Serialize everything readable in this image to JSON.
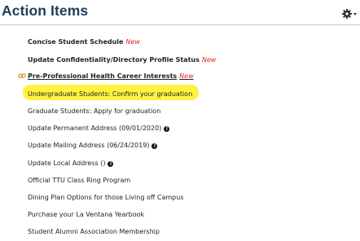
{
  "header": {
    "title": "Action Items",
    "icon": "gear-icon"
  },
  "items": [
    {
      "label": "Concise Student Schedule",
      "new": "New",
      "bold": true,
      "link": false,
      "info": false
    },
    {
      "label": "Update Confidentiality/Directory Profile Status",
      "new": "New",
      "bold": true,
      "link": false,
      "info": false
    },
    {
      "label": "Pre-Professional Health Career Interests",
      "new": "New",
      "bold": true,
      "link": true,
      "info": false,
      "icon": "chain-link-icon"
    },
    {
      "label": "Undergraduate Students: Confirm your graduation",
      "new": "",
      "bold": false,
      "link": false,
      "info": false,
      "highlighted": true
    },
    {
      "label": "Graduate Students: Apply for graduation",
      "new": "",
      "bold": false,
      "link": false,
      "info": false
    },
    {
      "label": "Update Permanent Address (09/01/2020)",
      "new": "",
      "bold": false,
      "link": false,
      "info": true
    },
    {
      "label": "Update Mailing Address (06/24/2019)",
      "new": "",
      "bold": false,
      "link": false,
      "info": true
    },
    {
      "label": "Update Local Address ()",
      "new": "",
      "bold": false,
      "link": false,
      "info": true
    },
    {
      "label": "Official TTU Class Ring Program",
      "new": "",
      "bold": false,
      "link": false,
      "info": false
    },
    {
      "label": "Dining Plan Options for those Living off Campus",
      "new": "",
      "bold": false,
      "link": false,
      "info": false
    },
    {
      "label": "Purchase your La Ventana Yearbook",
      "new": "",
      "bold": false,
      "link": false,
      "info": false
    },
    {
      "label": "Student Alumni Association Membership",
      "new": "",
      "bold": false,
      "link": false,
      "info": false
    }
  ],
  "colors": {
    "title": "#1d3c57",
    "new_badge": "#e02020",
    "highlight": "#fff240",
    "chain_icon": "#d98a1e"
  }
}
